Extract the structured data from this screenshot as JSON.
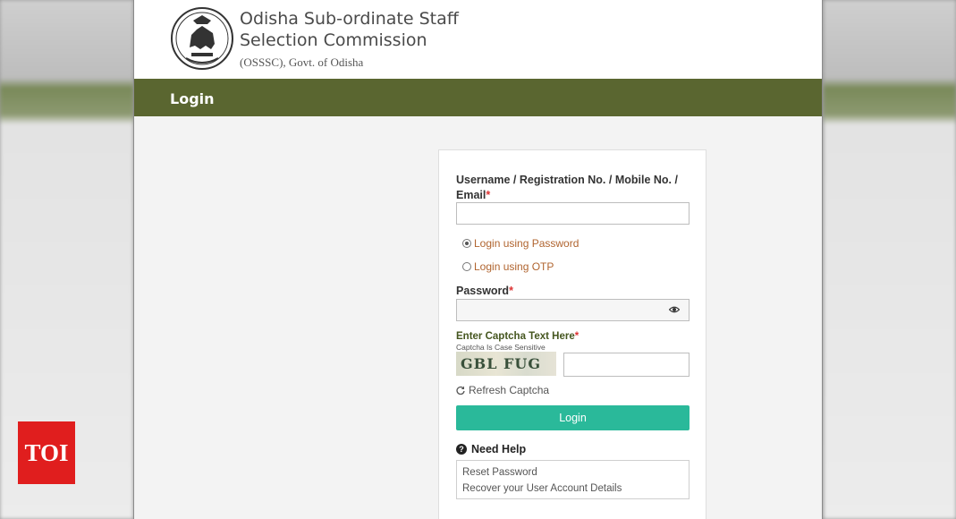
{
  "header": {
    "org_title_line1": "Odisha Sub-ordinate Staff",
    "org_title_line2": "Selection Commission",
    "org_subtitle": "(OSSSC), Govt. of Odisha"
  },
  "login_bar": {
    "title": "Login"
  },
  "form": {
    "username_label": "Username / Registration No. / Mobile No. /",
    "username_label_line2": "Email",
    "required_mark": "*",
    "username_value": "",
    "radio_password_label": "Login using Password",
    "radio_password_selected": true,
    "radio_otp_label": "Login using OTP",
    "radio_otp_selected": false,
    "password_label": "Password",
    "password_value": "",
    "captcha_label": "Enter Captcha Text Here",
    "captcha_note": "Captcha Is Case Sensitive",
    "captcha_text": "GBL FUG",
    "captcha_value": "",
    "refresh_label": "Refresh Captcha",
    "login_button": "Login"
  },
  "help": {
    "title": "Need Help",
    "links": [
      "Reset Password",
      "Recover your User Account Details"
    ]
  },
  "watermark": {
    "label": "TOI"
  },
  "colors": {
    "login_bar_bg": "#5a6630",
    "login_button_bg": "#2ab99a",
    "radio_label": "#b0642f",
    "required": "#d33333",
    "watermark_bg": "#e01e1e"
  }
}
